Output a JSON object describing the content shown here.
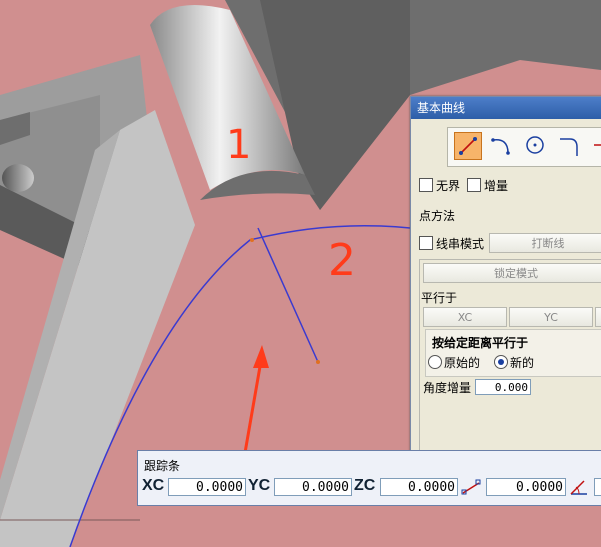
{
  "dialog": {
    "title": "基本曲线",
    "tools": [
      "line-icon",
      "arc-icon",
      "circle-icon",
      "fillet-icon",
      "plus-icon"
    ],
    "checkbox_unbounded": "无界",
    "checkbox_increment": "增量",
    "point_method": "点方法",
    "checkbox_string_mode": "线串模式",
    "break_string_button": "打断线",
    "lock_mode_button": "锁定模式",
    "parallel_to": "平行于",
    "xc_button": "XC",
    "yc_button": "YC",
    "by_distance_label": "按给定距离平行于",
    "radio_original": "原始的",
    "radio_new": "新的",
    "angle_increment_label": "角度增量",
    "angle_increment_value": "0.000"
  },
  "trackbar": {
    "title": "跟踪条",
    "xc_label": "XC",
    "xc_value": "0.0000",
    "yc_label": "YC",
    "yc_value": "0.0000",
    "zc_label": "ZC",
    "zc_value": "0.0000",
    "length_value": "0.0000"
  },
  "annotations": {
    "label_1": "1",
    "label_2": "2"
  },
  "colors": {
    "background": "#d08f8f",
    "curve": "#3a3ad0",
    "annotation": "#ff3b1a"
  }
}
